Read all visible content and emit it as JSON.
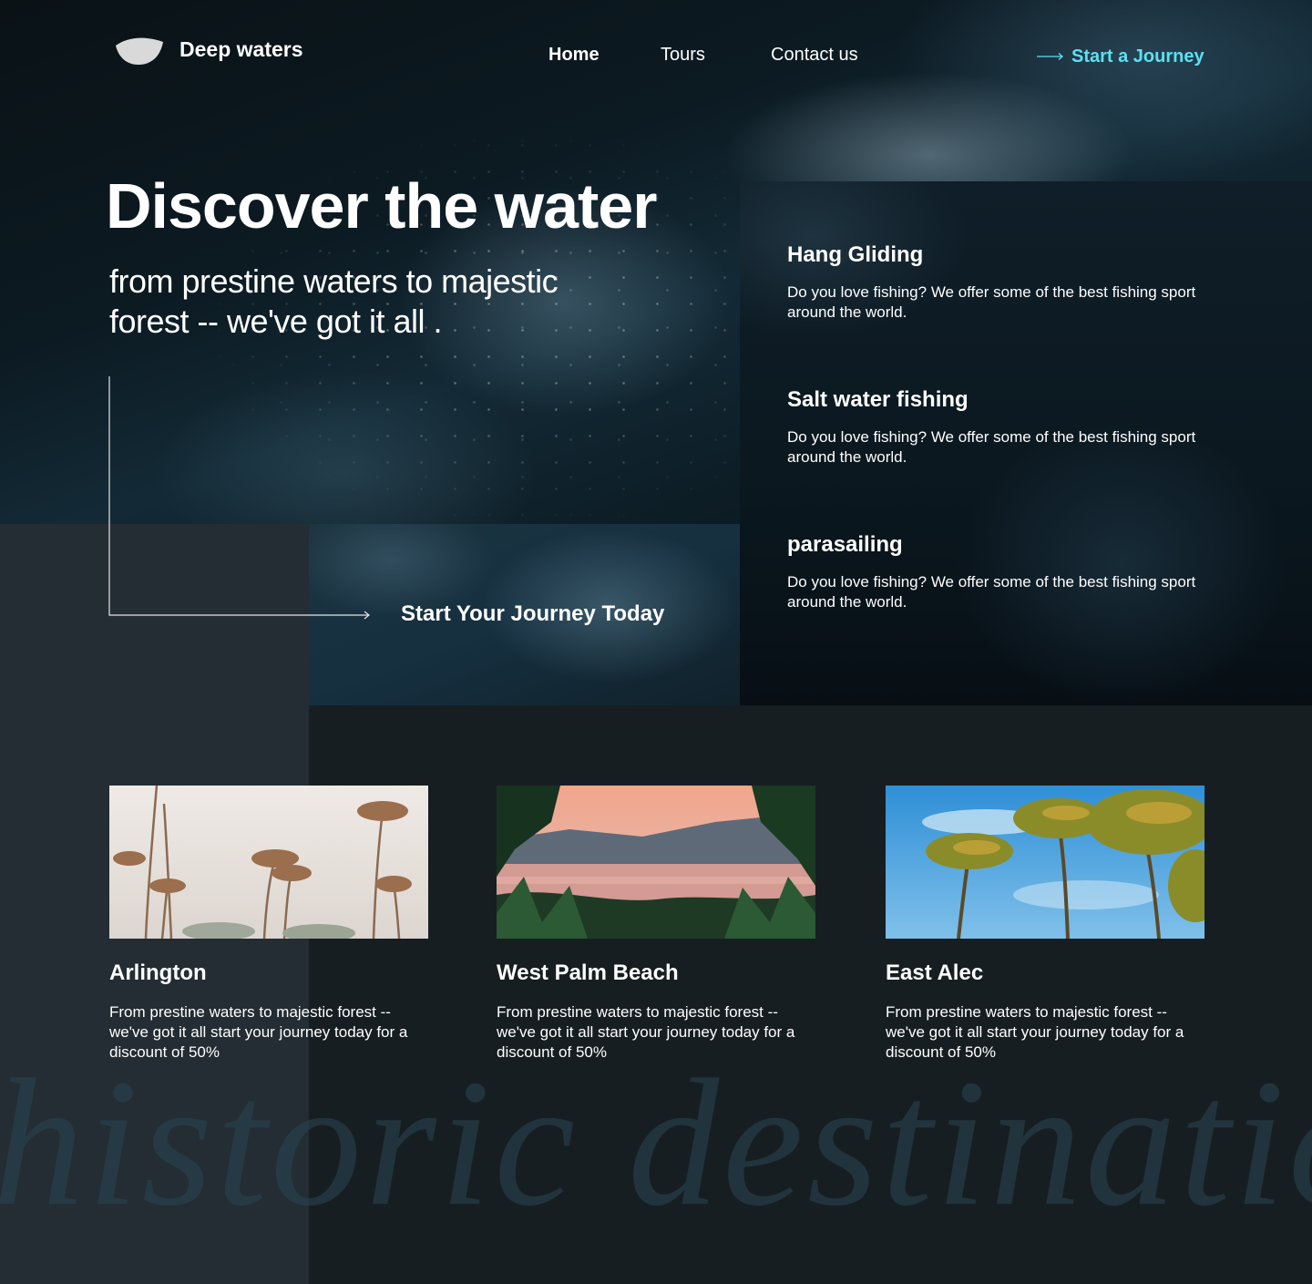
{
  "nav": {
    "brand": "Deep waters",
    "links": [
      "Home",
      "Tours",
      "Contact us"
    ],
    "cta": "Start a Journey"
  },
  "hero": {
    "title": "Discover the water",
    "subtitle": "from prestine waters to majestic forest -- we've  got it all .",
    "cta": "Start Your Journey Today"
  },
  "features": [
    {
      "title": "Hang Gliding",
      "text": "Do you love fishing? We offer some of the best fishing sport around the world."
    },
    {
      "title": "Salt water fishing",
      "text": "Do you love fishing? We offer some of the best fishing sport around the world."
    },
    {
      "title": "parasailing",
      "text": "Do you love fishing? We offer some of the best fishing sport around the world."
    }
  ],
  "destinations": [
    {
      "name": "Arlington",
      "text": "From prestine waters to majestic forest -- we've got it all start your journey today for a discount of 50%"
    },
    {
      "name": "West Palm Beach",
      "text": "From prestine waters to majestic forest -- we've got it all start your journey today for a discount of 50%"
    },
    {
      "name": "East Alec",
      "text": "From prestine waters to majestic forest -- we've got it all start your journey today for a discount of 50%"
    }
  ],
  "watermark": "historic destination",
  "colors": {
    "accent": "#5de0f0",
    "page_bg": "#171e22",
    "left_panel": "#232d33"
  }
}
